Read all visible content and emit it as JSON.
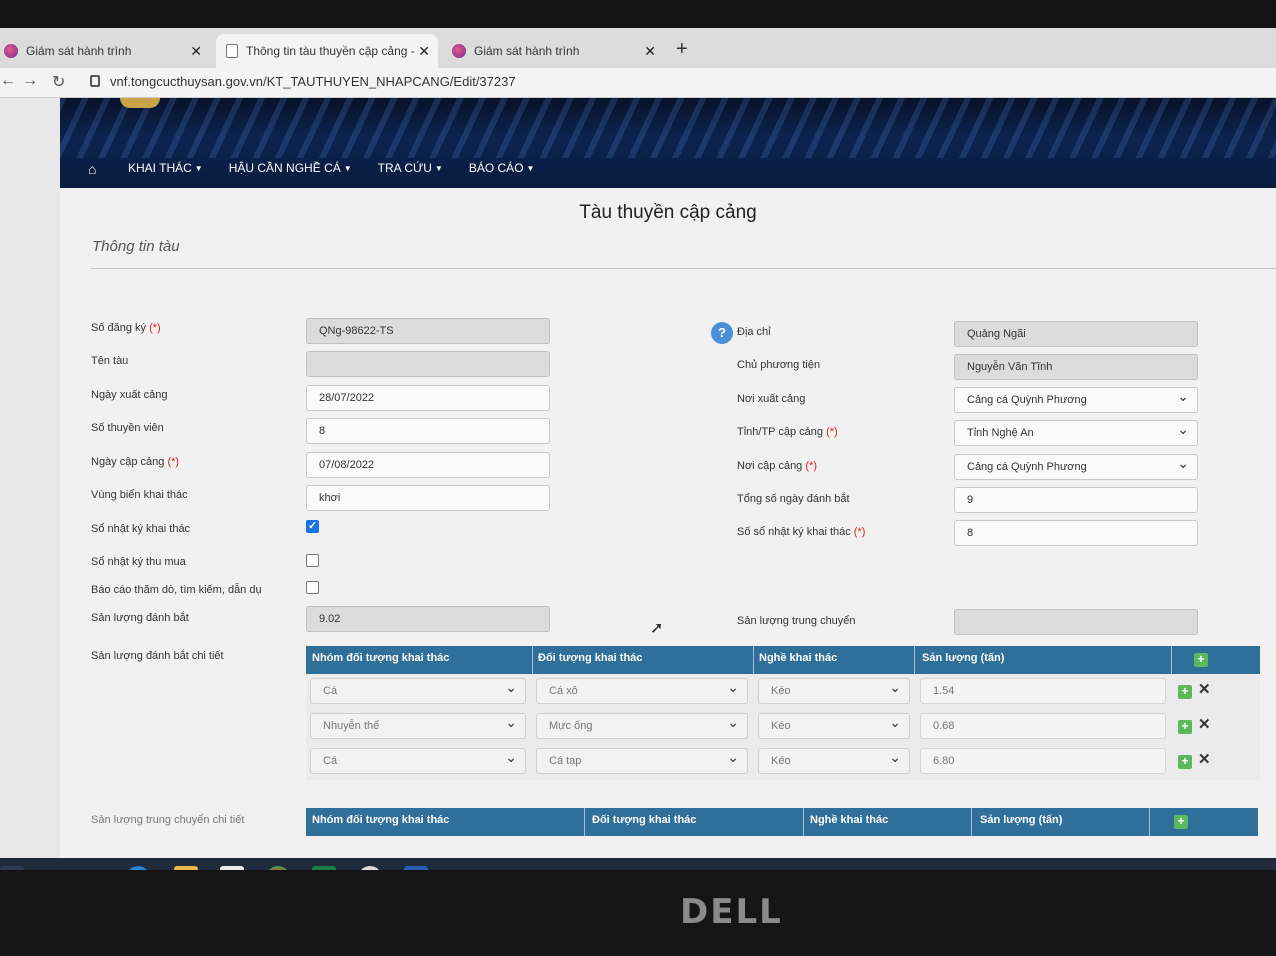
{
  "browser": {
    "tabs": [
      {
        "label": "Giám sát hành trình"
      },
      {
        "label": "Thông tin tàu thuyền cập cảng -"
      },
      {
        "label": "Giám sát hành trình"
      }
    ],
    "url": "vnf.tongcucthuysan.gov.vn/KT_TAUTHUYEN_NHAPCANG/Edit/37237"
  },
  "menu": {
    "items": [
      "KHAI THÁC",
      "HẬU CẦN NGHỀ CÁ",
      "TRA CỨU",
      "BÁO CÁO"
    ]
  },
  "page": {
    "title": "Tàu thuyền cập cảng",
    "section": "Thông tin tàu"
  },
  "left": {
    "so_dang_ky": {
      "label": "Số đăng ký",
      "req": "(*)",
      "value": "QNg-98622-TS"
    },
    "ten_tau": {
      "label": "Tên tàu",
      "value": ""
    },
    "ngay_xuat_cang": {
      "label": "Ngày xuất cảng",
      "value": "28/07/2022"
    },
    "so_thuyen_vien": {
      "label": "Số thuyền viên",
      "value": "8"
    },
    "ngay_cap_cang": {
      "label": "Ngày cập cảng",
      "req": "(*)",
      "value": "07/08/2022"
    },
    "vung_bien": {
      "label": "Vùng biển khai thác",
      "value": "khơi"
    },
    "so_nhat_ky_khai_thac": {
      "label": "Sổ nhật ký khai thác",
      "checked": true
    },
    "so_nhat_ky_thu_mua": {
      "label": "Sổ nhật ký thu mua",
      "checked": false
    },
    "bao_cao_tham_do": {
      "label": "Báo cáo thăm dò, tìm kiếm, dẫn dụ",
      "checked": false
    },
    "san_luong_danh_bat": {
      "label": "Sản lượng đánh bắt",
      "value": "9.02"
    },
    "san_luong_chi_tiet_label": "Sản lượng đánh bắt chi tiết",
    "trung_chuyen_chi_tiet_label": "Sản lượng trung chuyển chi tiết"
  },
  "right": {
    "dia_chi": {
      "label": "Địa chỉ",
      "value": "Quảng Ngãi"
    },
    "chu_phuong_tien": {
      "label": "Chủ phương tiện",
      "value": "Nguyễn Văn Tĩnh"
    },
    "noi_xuat_cang": {
      "label": "Nơi xuất cảng",
      "value": "Cảng cá Quỳnh Phương"
    },
    "tinh_cap_cang": {
      "label": "Tỉnh/TP cập cảng",
      "req": "(*)",
      "value": "Tỉnh Nghệ An"
    },
    "noi_cap_cang": {
      "label": "Nơi cập cảng",
      "req": "(*)",
      "value": "Cảng cá Quỳnh Phương"
    },
    "tong_so_ngay": {
      "label": "Tổng số ngày đánh bắt",
      "value": "9"
    },
    "so_so_nhat_ky": {
      "label": "Số sổ nhật ký khai thác",
      "req": "(*)",
      "value": "8"
    },
    "san_luong_trung_chuyen": {
      "label": "Sản lượng trung chuyển",
      "value": ""
    }
  },
  "catch_table": {
    "headers": [
      "Nhóm đối tượng khai thác",
      "Đối tượng khai thác",
      "Nghề khai thác",
      "Sản lượng (tấn)"
    ],
    "rows": [
      {
        "nhom": "Cá",
        "doi_tuong": "Cá xô",
        "nghe": "Kéo",
        "san_luong": "1.54"
      },
      {
        "nhom": "Nhuyễn thể",
        "doi_tuong": "Mực ống",
        "nghe": "Kéo",
        "san_luong": "0.68"
      },
      {
        "nhom": "Cá",
        "doi_tuong": "Cá tạp",
        "nghe": "Kéo",
        "san_luong": "6.80"
      }
    ]
  },
  "transfer_table": {
    "headers": [
      "Nhóm đối tượng khai thác",
      "Đối tượng khai thác",
      "Nghề khai thác",
      "Sản lượng (tấn)"
    ]
  },
  "monitor": {
    "brand": "DELL"
  }
}
